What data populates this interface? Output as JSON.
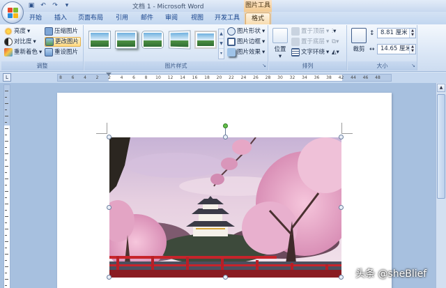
{
  "window": {
    "title": "文档 1 - Microsoft Word",
    "context_title": "图片工具"
  },
  "tabs": [
    {
      "label": "开始"
    },
    {
      "label": "插入"
    },
    {
      "label": "页面布局"
    },
    {
      "label": "引用"
    },
    {
      "label": "邮件"
    },
    {
      "label": "审阅"
    },
    {
      "label": "视图"
    },
    {
      "label": "开发工具"
    },
    {
      "label": "格式",
      "active": true
    }
  ],
  "ribbon": {
    "adjust": {
      "label": "调整",
      "brightness": "亮度",
      "contrast": "对比度",
      "recolor": "重新着色",
      "compress": "压缩图片",
      "change_picture": "更改图片",
      "reset_picture": "重设图片"
    },
    "picture_styles": {
      "label": "图片样式",
      "shape": "图片形状",
      "border": "图片边框",
      "effects": "图片效果"
    },
    "arrange": {
      "label": "排列",
      "position": "位置",
      "bring_front": "置于顶层",
      "send_back": "置于底层",
      "text_wrap": "文字环绕"
    },
    "size": {
      "label": "大小",
      "crop": "裁剪",
      "height": "8.81 厘米",
      "width": "14.65 厘米"
    }
  },
  "ruler_ticks": [
    "8",
    "6",
    "4",
    "2",
    "2",
    "4",
    "6",
    "8",
    "10",
    "12",
    "14",
    "16",
    "18",
    "20",
    "22",
    "24",
    "26",
    "28",
    "30",
    "32",
    "34",
    "36",
    "38",
    "42",
    "44",
    "46",
    "48"
  ],
  "watermark": "头条 @sheBlief",
  "colors": {
    "accent_tab": "#f7dcb0",
    "ribbon_bg": "#dbe7f6",
    "document_bg": "#a7c0df"
  }
}
